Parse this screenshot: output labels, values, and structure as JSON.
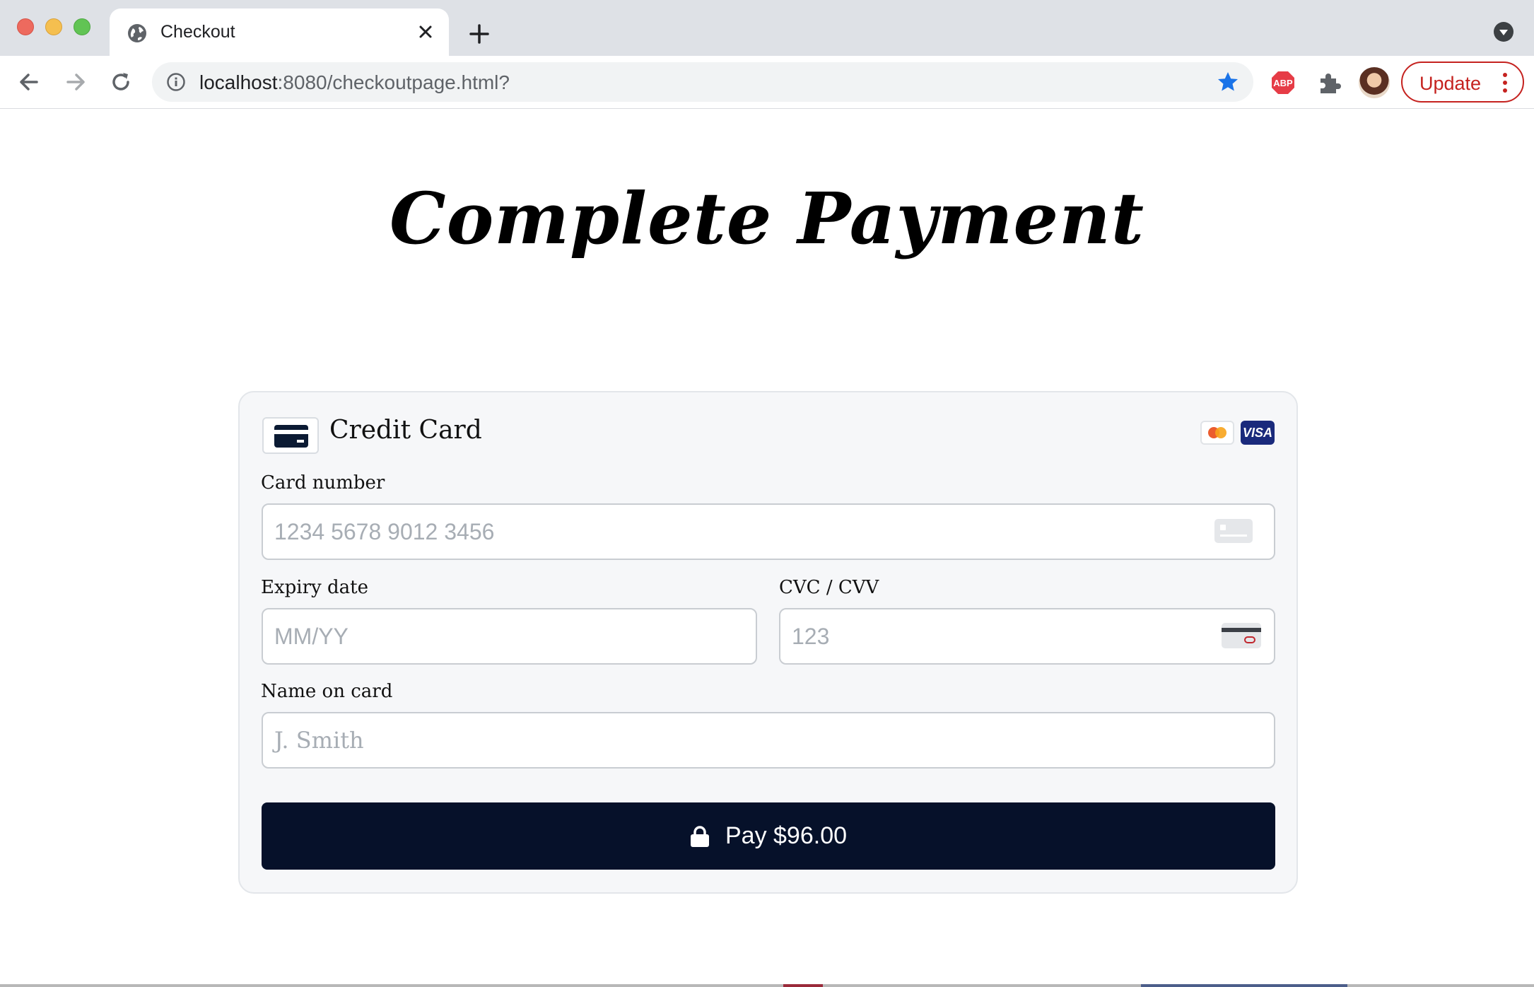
{
  "browser": {
    "tab_title": "Checkout",
    "url_host": "localhost",
    "url_rest": ":8080/checkoutpage.html?",
    "update_label": "Update",
    "bookmark_color": "#1a73e8",
    "update_color": "#c5221f"
  },
  "page": {
    "title": "Complete Payment"
  },
  "payment": {
    "method_label": "Credit Card",
    "brands": [
      "mastercard",
      "VISA"
    ],
    "card_number": {
      "label": "Card number",
      "placeholder": "1234 5678 9012 3456"
    },
    "expiry": {
      "label": "Expiry date",
      "placeholder": "MM/YY"
    },
    "cvc": {
      "label": "CVC / CVV",
      "placeholder": "123"
    },
    "name": {
      "label": "Name on card",
      "placeholder": "J. Smith"
    },
    "pay_button": "Pay $96.00",
    "button_color": "#06112a"
  },
  "icons": [
    "globe-icon",
    "close-icon",
    "plus-icon",
    "back-icon",
    "forward-icon",
    "reload-icon",
    "info-icon",
    "star-icon",
    "adblock-icon",
    "puzzle-icon",
    "kebab-icon",
    "credit-card-icon",
    "lock-icon"
  ]
}
